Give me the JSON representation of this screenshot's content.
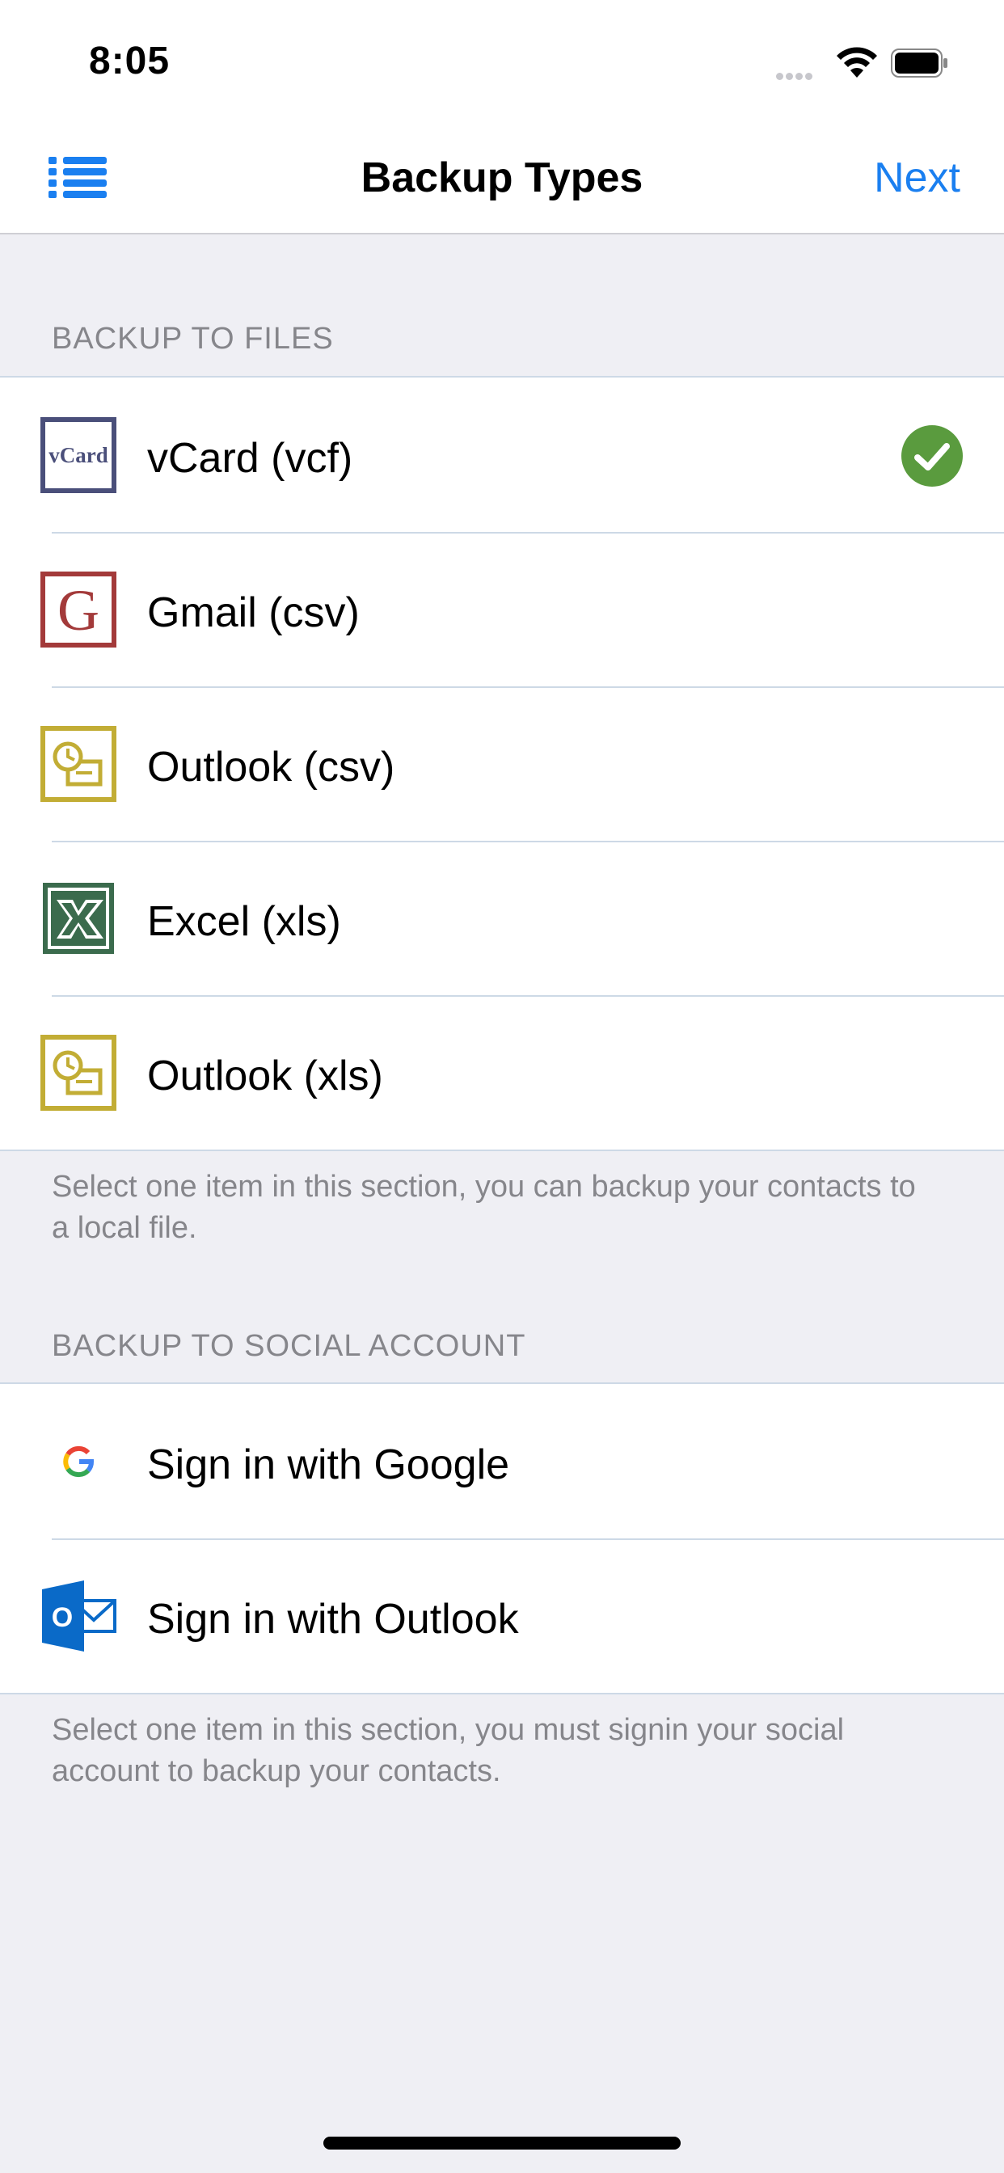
{
  "status_bar": {
    "time": "8:05"
  },
  "nav": {
    "title": "Backup Types",
    "next_label": "Next"
  },
  "files_section": {
    "header": "BACKUP TO FILES",
    "items": [
      {
        "label": "vCard (vcf)",
        "icon": "vcard-icon",
        "selected": true
      },
      {
        "label": "Gmail (csv)",
        "icon": "gmail-icon",
        "selected": false
      },
      {
        "label": "Outlook (csv)",
        "icon": "outlook-csv-icon",
        "selected": false
      },
      {
        "label": "Excel (xls)",
        "icon": "excel-icon",
        "selected": false
      },
      {
        "label": "Outlook (xls)",
        "icon": "outlook-xls-icon",
        "selected": false
      }
    ],
    "footer": "Select one item in this section, you can backup your contacts to a local file."
  },
  "social_section": {
    "header": "BACKUP TO SOCIAL ACCOUNT",
    "items": [
      {
        "label": "Sign in with Google",
        "icon": "google-icon"
      },
      {
        "label": "Sign in with Outlook",
        "icon": "outlook-mail-icon"
      }
    ],
    "footer": "Select one item in this section, you must signin your social account to backup your contacts."
  },
  "icon_text": {
    "vcard": "vCard",
    "gmail": "G",
    "outlook_mail": "O"
  },
  "colors": {
    "accent": "#1a7ff0",
    "check_green": "#5a9b3e",
    "vcard_border": "#4a4f7a",
    "gmail_red": "#a33a3a",
    "outlook_gold": "#c2ad35",
    "excel_green": "#3b6b4d",
    "outlook_blue": "#0a6ac8"
  }
}
